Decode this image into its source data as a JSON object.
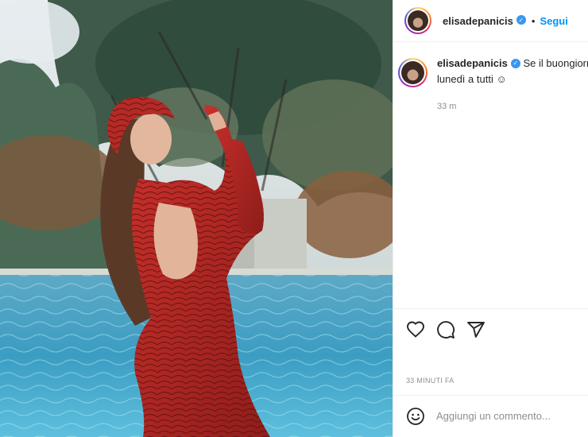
{
  "post": {
    "username": "elisadepanicis",
    "separator": "•",
    "follow_label": "Segui",
    "caption_line1": "Se il buongiorno",
    "caption_line2": "lunedì a tutti ☺",
    "relative_time": "33 m",
    "timestamp": "33 MINUTI FA",
    "comment_placeholder": "Aggiungi un commento...",
    "verified_glyph": "✓"
  },
  "icons": {
    "like": "heart-icon",
    "comment": "comment-icon",
    "share": "share-icon",
    "emoji": "emoji-icon",
    "verified": "verified-badge-icon"
  },
  "colors": {
    "accent": "#0095f6",
    "verified": "#3897f0",
    "muted": "#8e8e8e",
    "text": "#262626",
    "border": "#efefef"
  }
}
